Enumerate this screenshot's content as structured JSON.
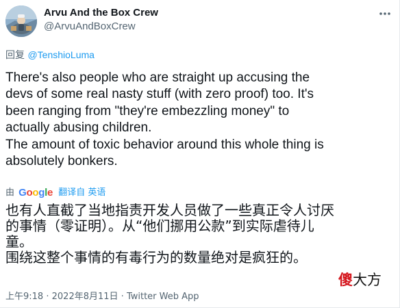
{
  "author": {
    "display_name": "Arvu And the Box Crew",
    "handle": "@ArvuAndBoxCrew"
  },
  "reply": {
    "label": "回复",
    "mention": "@TenshioLuma"
  },
  "tweet_text_lines": [
    "There's also people who are straight up accusing the",
    "devs of some real nasty stuff (with zero proof) too. It's",
    "been ranging from \"they're embezzling money\" to",
    "actually abusing children.",
    "The amount of toxic behavior around this whole thing is",
    "absolutely bonkers."
  ],
  "translation": {
    "by_label": "由",
    "provider": "Google",
    "provider_letter_colors": [
      "#4285f4",
      "#ea4335",
      "#fbbc05",
      "#4285f4",
      "#34a853",
      "#ea4335"
    ],
    "translate_link": "翻译自 英语",
    "lines": [
      "也有人直截了当地指责开发人员做了一些真正令人讨厌",
      "的事情（零证明）。从“他们挪用公款”到实际虐待儿",
      "童。",
      "围绕这整个事情的有毒行为的数量绝对是疯狂的。"
    ]
  },
  "footer": {
    "time": "上午9:18",
    "separator": "·",
    "date": "2022年8月11日",
    "client": "Twitter Web App"
  },
  "watermark": {
    "part_a": "傻",
    "part_b": "大方"
  },
  "icons": {
    "avatar": "avatar-image",
    "more": "more-options-icon"
  },
  "colors": {
    "link": "#1d9bf0",
    "secondary_text": "#536471",
    "primary_text": "#0f1419"
  }
}
